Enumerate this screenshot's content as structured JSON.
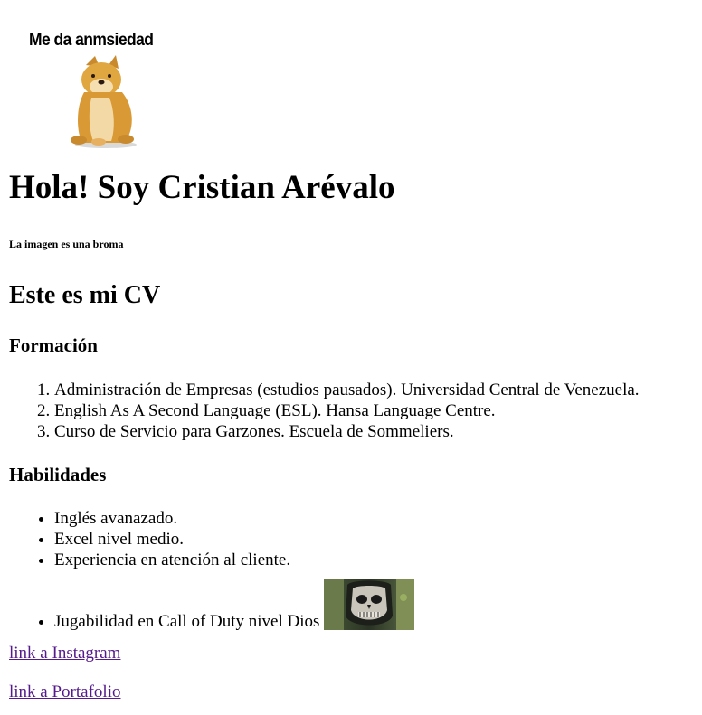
{
  "meme": {
    "caption": "Me da anmsiedad",
    "icon": "cheems-doge-image"
  },
  "header": {
    "title": "Hola! Soy Cristian Arévalo",
    "note": "La imagen es una broma"
  },
  "cv": {
    "heading": "Este es mi CV",
    "formacion": {
      "heading": "Formación",
      "items": [
        "Administración de Empresas (estudios pausados). Universidad Central de Venezuela.",
        "English As A Second Language (ESL). Hansa Language Centre.",
        "Curso de Servicio para Garzones. Escuela de Sommeliers."
      ]
    },
    "habilidades": {
      "heading": "Habilidades",
      "items": [
        "Inglés avanazado.",
        "Excel nivel medio.",
        "Experiencia en atención al cliente.",
        "Jugabilidad en Call of Duty nivel Dios"
      ],
      "last_item_icon": "ghost-skull-mask-image"
    }
  },
  "links": {
    "instagram": "link a Instagram",
    "portfolio": "link a Portafolio"
  },
  "colors": {
    "link_visited": "#551a8b",
    "text": "#000000",
    "background": "#ffffff"
  }
}
